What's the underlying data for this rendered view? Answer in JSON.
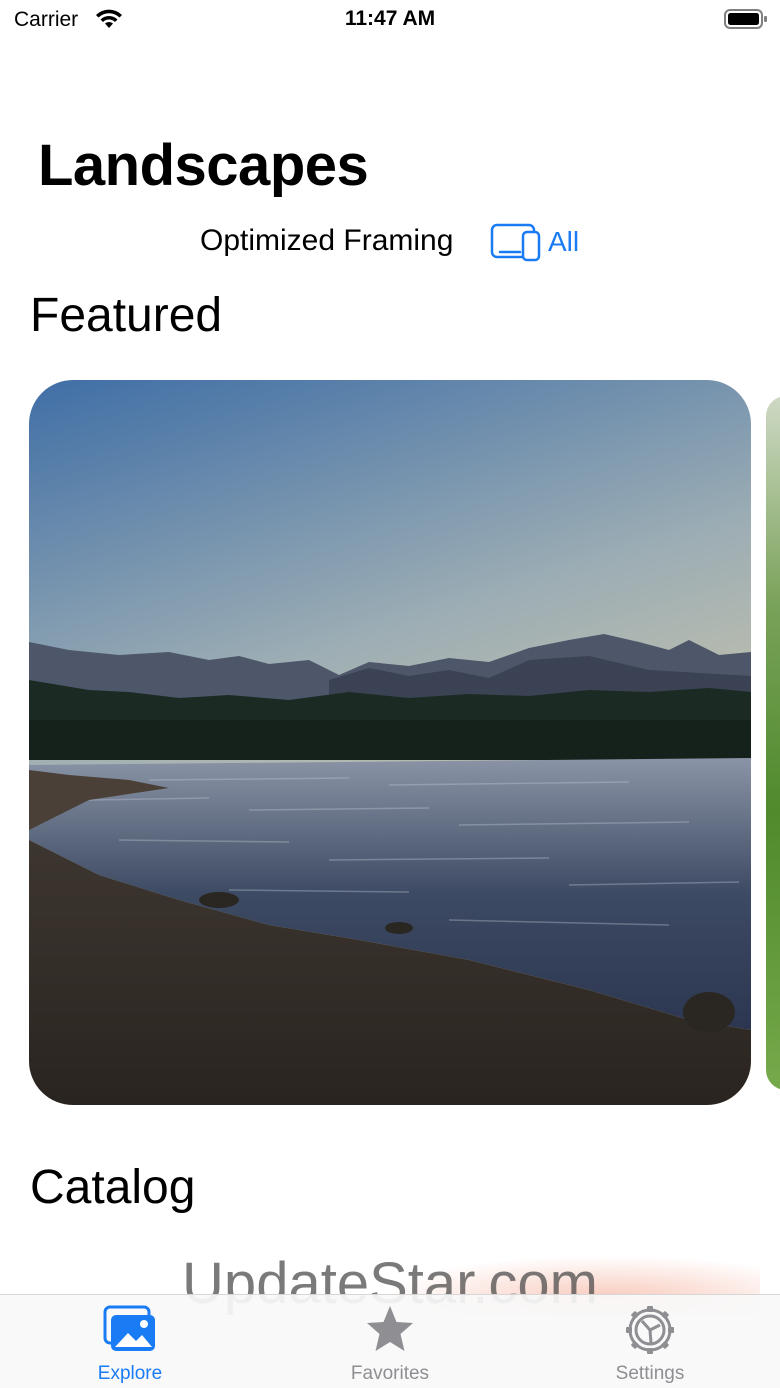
{
  "status_bar": {
    "carrier": "Carrier",
    "time": "11:47 AM"
  },
  "header": {
    "title": "Landscapes"
  },
  "framing": {
    "label": "Optimized Framing",
    "button_label": "All",
    "button_icon": "devices-icon"
  },
  "sections": {
    "featured": "Featured",
    "catalog": "Catalog"
  },
  "watermark": "UpdateStar.com",
  "tabs": [
    {
      "label": "Explore",
      "icon": "photos-icon",
      "selected": true
    },
    {
      "label": "Favorites",
      "icon": "star-icon",
      "selected": false
    },
    {
      "label": "Settings",
      "icon": "gear-icon",
      "selected": false
    }
  ],
  "colors": {
    "accent": "#1a7cf5",
    "inactive": "#8e8e93"
  }
}
